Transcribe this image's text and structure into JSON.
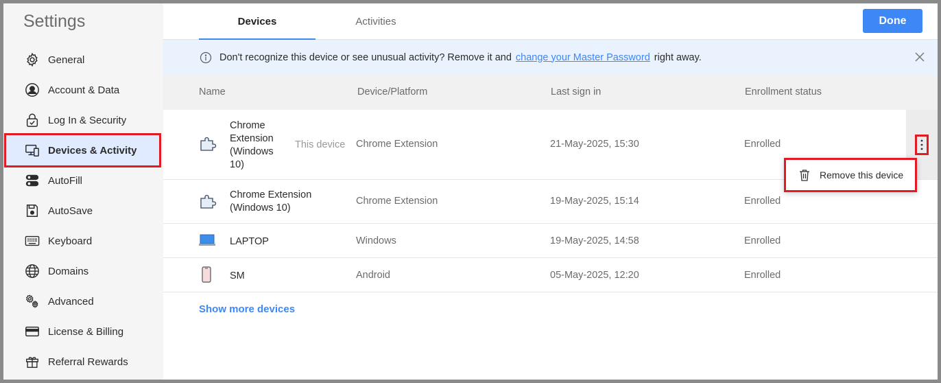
{
  "sidebar": {
    "title": "Settings",
    "items": [
      {
        "label": "General",
        "icon": "gear-icon"
      },
      {
        "label": "Account & Data",
        "icon": "user-icon"
      },
      {
        "label": "Log In & Security",
        "icon": "lock-icon"
      },
      {
        "label": "Devices & Activity",
        "icon": "devices-icon"
      },
      {
        "label": "AutoFill",
        "icon": "autofill-icon"
      },
      {
        "label": "AutoSave",
        "icon": "save-icon"
      },
      {
        "label": "Keyboard",
        "icon": "keyboard-icon"
      },
      {
        "label": "Domains",
        "icon": "globe-icon"
      },
      {
        "label": "Advanced",
        "icon": "advanced-gear-icon"
      },
      {
        "label": "License & Billing",
        "icon": "card-icon"
      },
      {
        "label": "Referral Rewards",
        "icon": "gift-icon"
      }
    ]
  },
  "tabs": [
    {
      "label": "Devices"
    },
    {
      "label": "Activities"
    }
  ],
  "done_label": "Done",
  "banner": {
    "text_before": "Don't recognize this device or see unusual activity? Remove it and",
    "link": "change your Master Password",
    "text_after": "right away."
  },
  "table": {
    "headers": [
      "Name",
      "Device/Platform",
      "Last sign in",
      "Enrollment status"
    ],
    "rows": [
      {
        "name": "Chrome Extension (Windows 10)",
        "tag": "This device",
        "platform": "Chrome Extension",
        "last_sign_in": "21-May-2025, 15:30",
        "status": "Enrolled",
        "icon": "extension-puzzle-icon"
      },
      {
        "name": "Chrome Extension (Windows 10)",
        "platform": "Chrome Extension",
        "last_sign_in": "19-May-2025, 15:14",
        "status": "Enrolled",
        "icon": "extension-puzzle-icon"
      },
      {
        "name": "LAPTOP",
        "platform": "Windows",
        "last_sign_in": "19-May-2025, 14:58",
        "status": "Enrolled",
        "icon": "laptop-icon"
      },
      {
        "name": "SM",
        "platform": "Android",
        "last_sign_in": "05-May-2025, 12:20",
        "status": "Enrolled",
        "icon": "phone-icon"
      }
    ]
  },
  "dropdown": {
    "remove_label": "Remove this device"
  },
  "show_more_label": "Show more devices",
  "colors": {
    "accent": "#3e87f7",
    "highlight": "#e01b24",
    "active_bg": "#e1ebff"
  }
}
